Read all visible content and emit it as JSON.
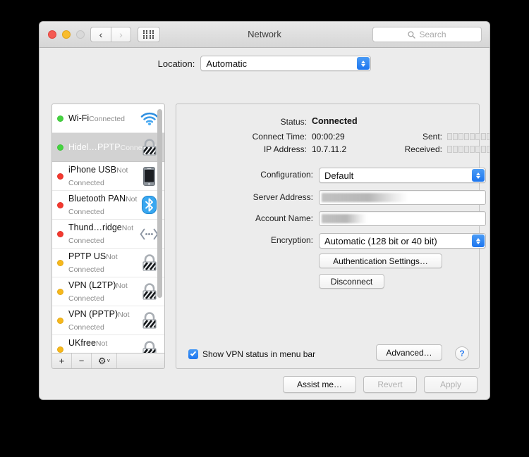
{
  "window": {
    "title": "Network",
    "traffic_lights": [
      "close",
      "minimize",
      "zoom-disabled"
    ],
    "back_label": "‹",
    "forward_label": "›",
    "grid_icon": "grid-icon",
    "search_placeholder": "Search"
  },
  "location": {
    "label": "Location:",
    "value": "Automatic"
  },
  "sidebar": {
    "services": [
      {
        "name": "Wi-Fi",
        "state": "Connected",
        "dot": "green",
        "icon": "wifi-icon",
        "selected": false
      },
      {
        "name": "Hidel…PPTP",
        "state": "Connected",
        "dot": "green",
        "icon": "vpn-lock-icon",
        "selected": true
      },
      {
        "name": "iPhone USB",
        "state": "Not Connected",
        "dot": "red",
        "icon": "iphone-icon",
        "selected": false
      },
      {
        "name": "Bluetooth PAN",
        "state": "Not Connected",
        "dot": "red",
        "icon": "bluetooth-icon",
        "selected": false
      },
      {
        "name": "Thund…ridge",
        "state": "Not Connected",
        "dot": "red",
        "icon": "thunderbolt-icon",
        "selected": false
      },
      {
        "name": "PPTP US",
        "state": "Not Connected",
        "dot": "yellow",
        "icon": "vpn-lock-icon",
        "selected": false
      },
      {
        "name": "VPN (L2TP)",
        "state": "Not Connected",
        "dot": "yellow",
        "icon": "vpn-lock-icon",
        "selected": false
      },
      {
        "name": "VPN (PPTP)",
        "state": "Not Connected",
        "dot": "yellow",
        "icon": "vpn-lock-icon",
        "selected": false
      },
      {
        "name": "UKfree",
        "state": "Not Connected",
        "dot": "yellow",
        "icon": "vpn-lock-icon",
        "selected": false
      }
    ],
    "toolbar": {
      "add_label": "+",
      "remove_label": "−",
      "gear_label": "⚙",
      "gear_chevron": "˅"
    }
  },
  "detail": {
    "status_label": "Status:",
    "status_value": "Connected",
    "connect_time_label": "Connect Time:",
    "connect_time_value": "00:00:29",
    "ip_address_label": "IP Address:",
    "ip_address_value": "10.7.11.2",
    "sent_label": "Sent:",
    "sent_boxes": 10,
    "received_label": "Received:",
    "received_boxes": 10,
    "configuration_label": "Configuration:",
    "configuration_value": "Default",
    "server_address_label": "Server Address:",
    "server_address_value": "",
    "account_name_label": "Account Name:",
    "account_name_value": "",
    "encryption_label": "Encryption:",
    "encryption_value": "Automatic (128 bit or 40 bit)",
    "auth_settings_label": "Authentication Settings…",
    "disconnect_label": "Disconnect",
    "show_vpn_status_label": "Show VPN status in menu bar",
    "show_vpn_status_checked": true,
    "advanced_label": "Advanced…",
    "help_label": "?"
  },
  "footer": {
    "assist_label": "Assist me…",
    "revert_label": "Revert",
    "revert_disabled": true,
    "apply_label": "Apply",
    "apply_disabled": true
  },
  "colors": {
    "accent_blue": "#1d76ef",
    "connected_green": "#45d440",
    "disconnected_red": "#f4392f",
    "idle_yellow": "#f7b81b",
    "window_bg": "#ececec",
    "selection_gray": "#d2d2d2"
  }
}
